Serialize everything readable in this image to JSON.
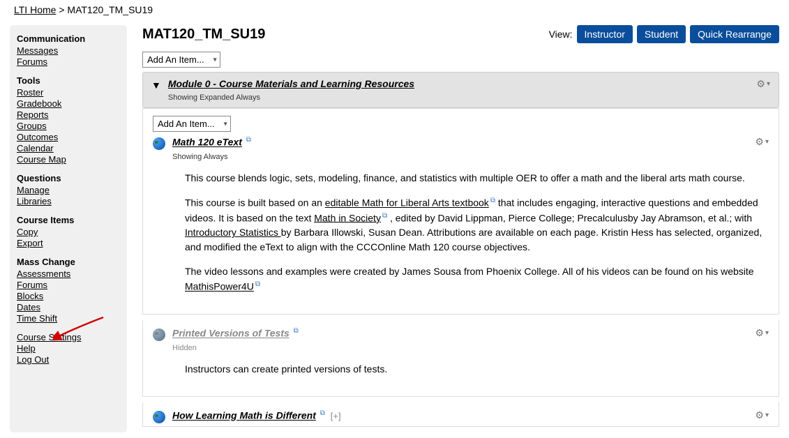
{
  "breadcrumb": {
    "home": "LTI Home",
    "sep": ">",
    "current": "MAT120_TM_SU19"
  },
  "page": {
    "title": "MAT120_TM_SU19",
    "view_label": "View:"
  },
  "view_buttons": {
    "instructor": "Instructor",
    "student": "Student",
    "rearrange": "Quick Rearrange"
  },
  "sidebar": {
    "communication": {
      "heading": "Communication",
      "messages": "Messages",
      "forums": "Forums"
    },
    "tools": {
      "heading": "Tools",
      "roster": "Roster",
      "gradebook": "Gradebook",
      "reports": "Reports",
      "groups": "Groups",
      "outcomes": "Outcomes",
      "calendar": "Calendar",
      "coursemap": "Course Map"
    },
    "questions": {
      "heading": "Questions",
      "manage": "Manage",
      "libraries": "Libraries"
    },
    "courseitems": {
      "heading": "Course Items",
      "copy": "Copy",
      "export": "Export"
    },
    "masschange": {
      "heading": "Mass Change",
      "assessments": "Assessments",
      "forums": "Forums",
      "blocks": "Blocks",
      "dates": "Dates",
      "timeshift": "Time Shift"
    },
    "bottom": {
      "settings": "Course Settings",
      "help": "Help",
      "logout": "Log Out"
    }
  },
  "add_item": "Add An Item...",
  "module0": {
    "title": "Module 0 - Course Materials and Learning Resources",
    "sub": "Showing Expanded Always"
  },
  "item_etext": {
    "title": "Math 120 eText",
    "sub": "Showing Always",
    "p1": "This course blends logic, sets, modeling, finance, and statistics with multiple OER to offer a math and the liberal arts math course.",
    "p2a": "This course is built based on an ",
    "link1": "editable Math for Liberal Arts textbook",
    "p2b": " that includes engaging, interactive questions and embedded videos. It is based on the text ",
    "link2": "Math in Society",
    "p2c": " , edited by David Lippman, Pierce College; Precalculusby Jay Abramson, et al.; with ",
    "link3": "Introductory Statistics ",
    "p2d": "by Barbara Illowski, Susan Dean.  Attributions are available on each page.   Kristin Hess has selected, organized, and modified the eText to align with the CCCOnline Math 120 course objectives.",
    "p3a": "The video lessons and examples were created by James Sousa from Phoenix College. All of his videos can be found on his website ",
    "link4": "MathisPower4U"
  },
  "item_tests": {
    "title": "Printed Versions of Tests",
    "sub": "Hidden",
    "p1": "Instructors can create printed versions of tests."
  },
  "item_learning": {
    "title": "How Learning Math is Different"
  }
}
